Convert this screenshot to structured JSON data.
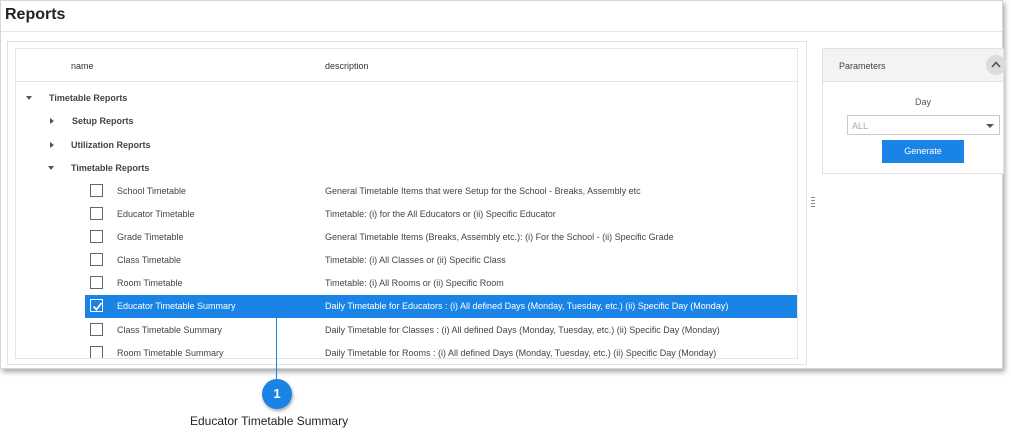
{
  "page": {
    "title": "Reports"
  },
  "table": {
    "headers": {
      "name": "name",
      "description": "description"
    },
    "groups": [
      {
        "label": "Timetable Reports"
      },
      {
        "label": "Setup Reports"
      },
      {
        "label": "Utilization Reports"
      },
      {
        "label": "Timetable Reports"
      }
    ],
    "rows": [
      {
        "name": "School Timetable",
        "description": "General Timetable Items that were Setup for the School - Breaks, Assembly etc",
        "checked": false
      },
      {
        "name": "Educator Timetable",
        "description": "Timetable: (i) for the All Educators or (ii) Specific Educator",
        "checked": false
      },
      {
        "name": "Grade Timetable",
        "description": "General Timetable Items (Breaks, Assembly etc.): (i) For the School - (ii) Specific Grade",
        "checked": false
      },
      {
        "name": "Class Timetable",
        "description": "Timetable: (i) All Classes or (ii) Specific Class",
        "checked": false
      },
      {
        "name": "Room Timetable",
        "description": "Timetable: (i) All Rooms or (ii) Specific Room",
        "checked": false
      },
      {
        "name": "Educator Timetable Summary",
        "description": "Daily Timetable for Educators : (i) All defined Days (Monday, Tuesday, etc.) (ii) Specific Day (Monday)",
        "checked": true
      },
      {
        "name": "Class Timetable Summary",
        "description": "Daily Timetable for Classes : (i) All defined Days (Monday, Tuesday, etc.) (ii) Specific Day (Monday)",
        "checked": false
      },
      {
        "name": "Room Timetable Summary",
        "description": "Daily Timetable for Rooms : (i) All defined Days (Monday, Tuesday, etc.) (ii) Specific Day (Monday)",
        "checked": false
      }
    ]
  },
  "parameters": {
    "title": "Parameters",
    "day_label": "Day",
    "day_value": "ALL",
    "generate_label": "Generate"
  },
  "callout": {
    "number": "1",
    "caption": "Educator Timetable Summary"
  },
  "colors": {
    "accent": "#1a84e6"
  }
}
